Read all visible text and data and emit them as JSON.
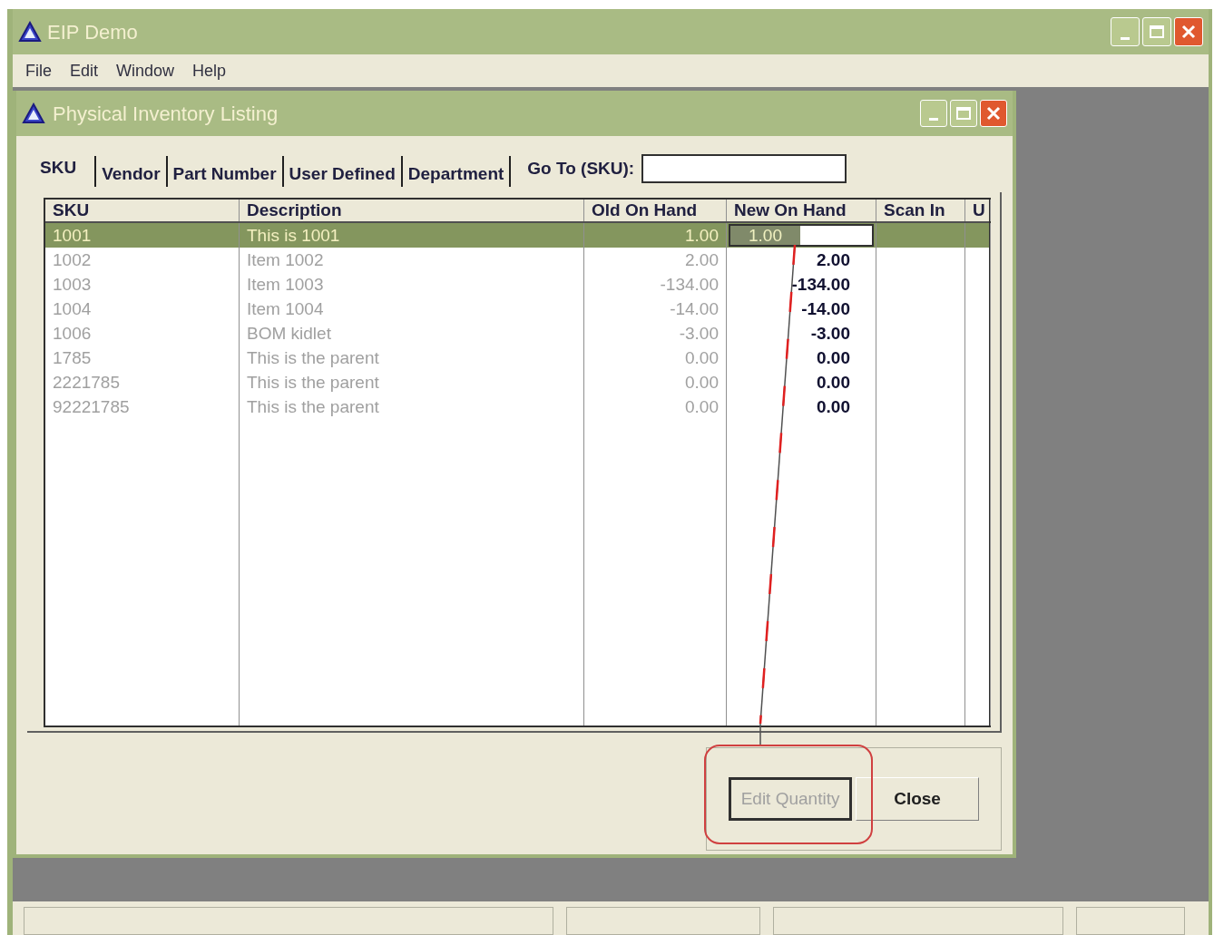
{
  "window": {
    "title": "EIP Demo"
  },
  "menu": [
    "File",
    "Edit",
    "Window",
    "Help"
  ],
  "child_window": {
    "title": "Physical Inventory Listing"
  },
  "tabs": [
    {
      "label": "SKU",
      "selected": true
    },
    {
      "label": "Vendor",
      "selected": false
    },
    {
      "label": "Part Number",
      "selected": false
    },
    {
      "label": "User Defined",
      "selected": false
    },
    {
      "label": "Department",
      "selected": false
    }
  ],
  "goto": {
    "label": "Go To (SKU):"
  },
  "table": {
    "columns": [
      "SKU",
      "Description",
      "Old On Hand",
      "New On Hand",
      "Scan In",
      "U"
    ],
    "rows": [
      {
        "sku": "1001",
        "description": "This is 1001",
        "old_on_hand": "1.00",
        "new_on_hand": "1.00",
        "selected": true,
        "editing": true
      },
      {
        "sku": "1002",
        "description": "Item 1002",
        "old_on_hand": "2.00",
        "new_on_hand": "2.00",
        "selected": false,
        "editing": false
      },
      {
        "sku": "1003",
        "description": "Item 1003",
        "old_on_hand": "-134.00",
        "new_on_hand": "-134.00",
        "selected": false,
        "editing": false
      },
      {
        "sku": "1004",
        "description": "Item 1004",
        "old_on_hand": "-14.00",
        "new_on_hand": "-14.00",
        "selected": false,
        "editing": false
      },
      {
        "sku": "1006",
        "description": "BOM kidlet",
        "old_on_hand": "-3.00",
        "new_on_hand": "-3.00",
        "selected": false,
        "editing": false
      },
      {
        "sku": "1785",
        "description": "This is the parent",
        "old_on_hand": "0.00",
        "new_on_hand": "0.00",
        "selected": false,
        "editing": false
      },
      {
        "sku": "2221785",
        "description": "This is the parent",
        "old_on_hand": "0.00",
        "new_on_hand": "0.00",
        "selected": false,
        "editing": false
      },
      {
        "sku": "92221785",
        "description": "This is the parent",
        "old_on_hand": "0.00",
        "new_on_hand": "0.00",
        "selected": false,
        "editing": false
      }
    ]
  },
  "buttons": [
    {
      "label": "Edit Quantity",
      "disabled": true,
      "focused": true
    },
    {
      "label": "Close",
      "disabled": false,
      "focused": false
    }
  ]
}
